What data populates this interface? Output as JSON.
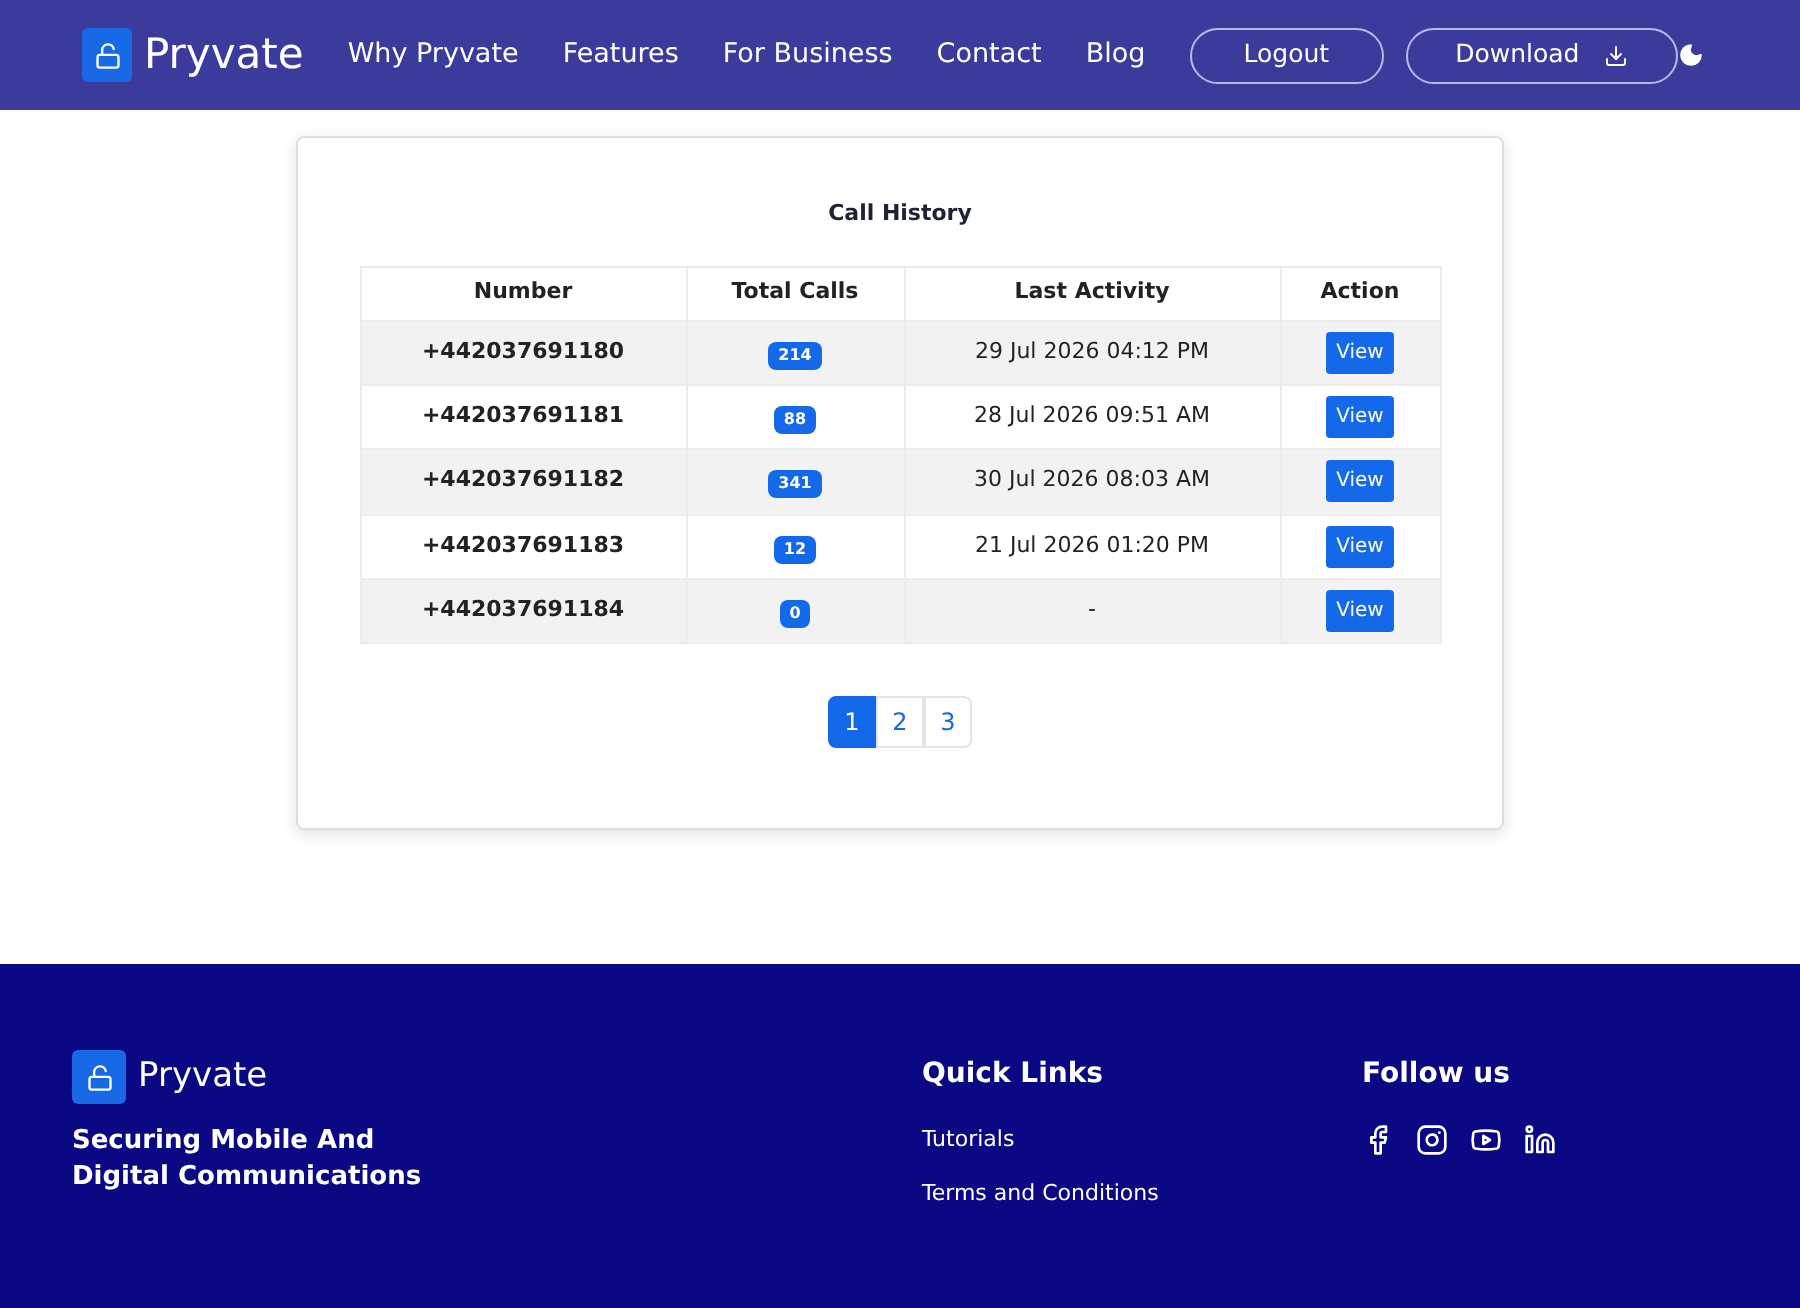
{
  "header": {
    "brand": "Pryvate",
    "nav": [
      "Why Pryvate",
      "Features",
      "For Business",
      "Contact",
      "Blog"
    ],
    "logout": "Logout",
    "download": "Download"
  },
  "call_history": {
    "title": "Call History",
    "columns": [
      "Number",
      "Total Calls",
      "Last Activity",
      "Action"
    ],
    "rows": [
      {
        "number": "+442037691180",
        "total_calls": "214",
        "last_activity": "29 Jul 2026 04:12 PM",
        "action": "View"
      },
      {
        "number": "+442037691181",
        "total_calls": "88",
        "last_activity": "28 Jul 2026 09:51 AM",
        "action": "View"
      },
      {
        "number": "+442037691182",
        "total_calls": "341",
        "last_activity": "30 Jul 2026 08:03 AM",
        "action": "View"
      },
      {
        "number": "+442037691183",
        "total_calls": "12",
        "last_activity": "21 Jul 2026 01:20 PM",
        "action": "View"
      },
      {
        "number": "+442037691184",
        "total_calls": "0",
        "last_activity": "-",
        "action": "View"
      }
    ],
    "pagination": [
      {
        "label": "1",
        "selected": true
      },
      {
        "label": "2",
        "selected": false
      },
      {
        "label": "3",
        "selected": false
      }
    ]
  },
  "footer": {
    "brand": "Pryvate",
    "tagline": [
      "Securing Mobile And",
      "Digital Communications"
    ],
    "quick_links_title": "Quick Links",
    "quick_links": [
      "Tutorials",
      "Terms and Conditions"
    ],
    "follow_title": "Follow us"
  }
}
